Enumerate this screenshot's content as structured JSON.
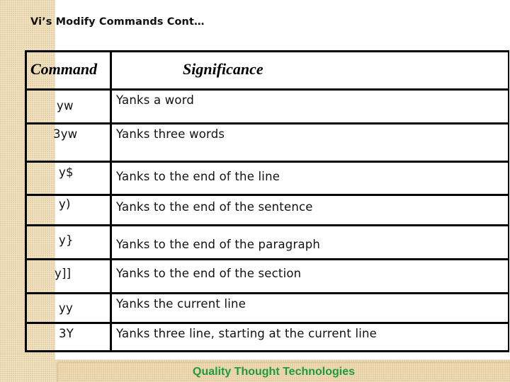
{
  "slide": {
    "title": "Vi’s Modify Commands Cont…",
    "colors": {
      "background_strip": "#f1e2c0",
      "footer_text": "#1e9a3c",
      "border": "#000000"
    }
  },
  "table": {
    "headers": {
      "command": "Command",
      "significance": "Significance"
    },
    "rows": [
      {
        "command": "yw",
        "significance": "Yanks a word"
      },
      {
        "command": "3yw",
        "significance": "Yanks three words"
      },
      {
        "command": "y$",
        "significance": "Yanks to the end of the line"
      },
      {
        "command": "y)",
        "significance": "Yanks to the end of the sentence"
      },
      {
        "command": "y}",
        "significance": "Yanks to the end of the paragraph"
      },
      {
        "command": "y]]",
        "significance": "Yanks to the end of the section"
      },
      {
        "command": "yy",
        "significance": "Yanks the current line"
      },
      {
        "command": "3Y",
        "significance": "Yanks three line, starting at the current line"
      }
    ]
  },
  "footer": {
    "text": "Quality Thought Technologies"
  }
}
